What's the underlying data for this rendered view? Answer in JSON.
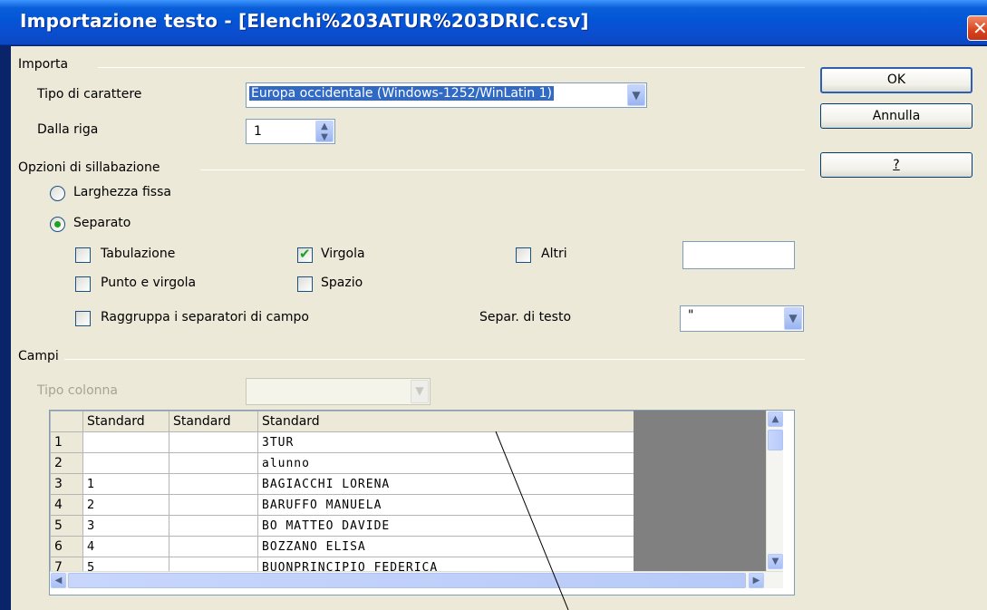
{
  "window": {
    "title": "Importazione testo - [Elenchi%203ATUR%203DRIC.csv]"
  },
  "buttons": {
    "ok": "OK",
    "cancel": "Annulla",
    "help": "?"
  },
  "import": {
    "section": "Importa",
    "charset_label": "Tipo di carattere",
    "charset_value": "Europa occidentale (Windows-1252/WinLatin 1)",
    "from_row_label": "Dalla riga",
    "from_row_value": "1"
  },
  "separator_options": {
    "section": "Opzioni di sillabazione",
    "fixed_width": "Larghezza fissa",
    "separated": "Separato",
    "tab": "Tabulazione",
    "comma": "Virgola",
    "other": "Altri",
    "other_value": "",
    "semicolon": "Punto e virgola",
    "space": "Spazio",
    "merge": "Raggruppa i separatori di campo",
    "text_delim_label": "Separ. di testo",
    "text_delim_value": "\"",
    "checked": {
      "tab": false,
      "comma": true,
      "other": false,
      "semicolon": false,
      "space": false,
      "merge": false
    },
    "selected_mode": "separated"
  },
  "fields": {
    "section": "Campi",
    "column_type_label": "Tipo colonna",
    "headers": [
      "Standard",
      "Standard",
      "Standard"
    ],
    "rows": [
      {
        "n": "1",
        "c1": "",
        "c2": "",
        "c3": "3TUR"
      },
      {
        "n": "2",
        "c1": "",
        "c2": "",
        "c3": "alunno"
      },
      {
        "n": "3",
        "c1": "1",
        "c2": "",
        "c3": "BAGIACCHI LORENA"
      },
      {
        "n": "4",
        "c1": "2",
        "c2": "",
        "c3": "BARUFFO MANUELA"
      },
      {
        "n": "5",
        "c1": "3",
        "c2": "",
        "c3": "BO MATTEO DAVIDE"
      },
      {
        "n": "6",
        "c1": "4",
        "c2": "",
        "c3": "BOZZANO ELISA"
      },
      {
        "n": "7",
        "c1": "5",
        "c2": "",
        "c3": "BUONPRINCIPIO FEDERICA"
      }
    ]
  },
  "icons": {
    "close": "close-icon",
    "dropdown": "chevron-down-icon",
    "spin": "spin-updown-icon",
    "scroll_up": "arrow-up-icon",
    "scroll_down": "arrow-down-icon",
    "scroll_left": "arrow-left-icon",
    "scroll_right": "arrow-right-icon"
  },
  "colors": {
    "titlebar": "#0355d6",
    "dialog_bg": "#ece9d8",
    "check": "#21a121",
    "grid_gray": "#808080"
  }
}
